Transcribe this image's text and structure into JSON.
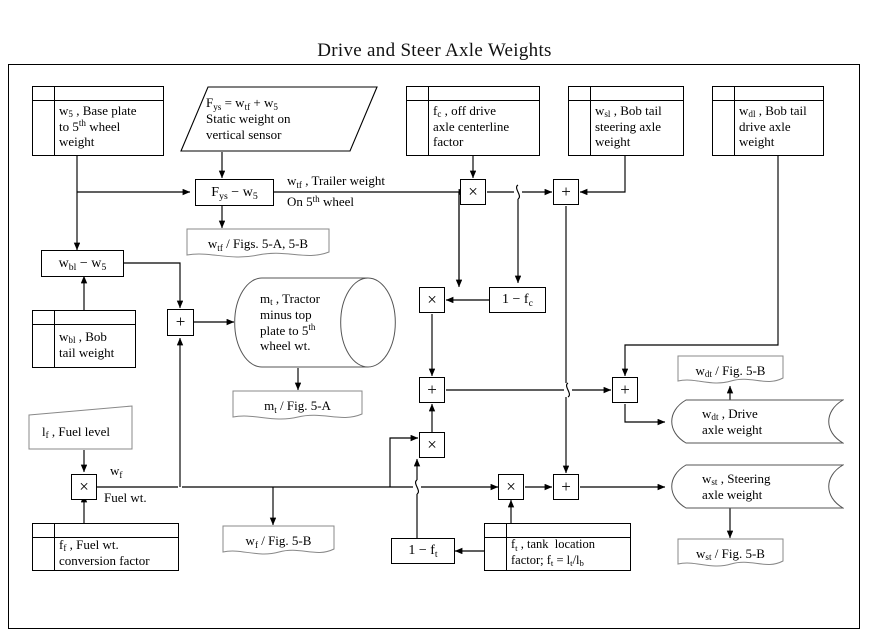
{
  "title": "Drive and Steer Axle Weights",
  "nodes": {
    "base_plate": "w₅ , Base plate to 5ᵗʰ wheel weight",
    "static_weight": "Fys = wtf + w₅ Static weight on vertical sensor",
    "off_drive": "fc , off drive axle centerline factor",
    "bobtail_steer": "wsl , Bob tail steering axle weight",
    "bobtail_drive": "wdl , Bob tail drive axle weight",
    "fys_minus_w5": "Fys − w₅",
    "wtf_figs": "wtf / Figs. 5-A, 5-B",
    "wbl_minus_w5": "wbl − w₅",
    "bobtail_weight": "wbl , Bob tail weight",
    "tractor_cyl": "mt , Tractor minus top plate to 5ᵗʰ wheel wt.",
    "mt_fig": "mt / Fig. 5-A",
    "one_minus_fc": "1 − fc",
    "fuel_level": "lf , Fuel level",
    "fuel_factor": "ff , Fuel wt. conversion factor",
    "wf_fig": "wf / Fig. 5-B",
    "one_minus_ft": "1 − ft",
    "tank_factor": "ft , tank location factor; ft = lt/lb",
    "wdt_fig": "wdt / Fig. 5-B",
    "drive_axle": "wdt , Drive axle weight",
    "steer_axle": "wst , Steering axle weight",
    "wst_fig": "wst / Fig. 5-B"
  },
  "operators": {
    "plus": "+",
    "times": "×"
  },
  "edge_labels": {
    "trailer_weight_l1": "wtf , Trailer weight",
    "trailer_weight_l2": "On 5ᵗʰ wheel",
    "fuel_wt_l1": "wf",
    "fuel_wt_l2": "Fuel wt."
  },
  "colors": {
    "line": "#000000",
    "text": "#000000",
    "background": "#ffffff"
  }
}
